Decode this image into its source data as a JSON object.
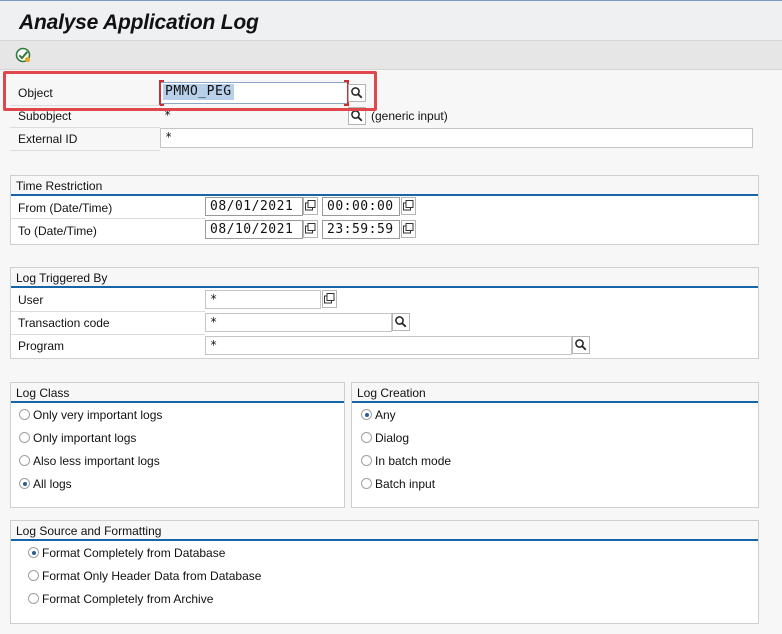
{
  "window": {
    "title": "Analyse Application Log"
  },
  "toolbar": {
    "execute_icon": "execute-icon"
  },
  "object": {
    "label": "Object",
    "value": "PMMO_PEG"
  },
  "subobject": {
    "label": "Subobject",
    "value": "*",
    "hint": "(generic input)"
  },
  "external_id": {
    "label": "External ID",
    "value": "*"
  },
  "time_restriction": {
    "title": "Time Restriction",
    "from": {
      "label": "From (Date/Time)",
      "date": "08/01/2021",
      "time": "00:00:00"
    },
    "to": {
      "label": "To (Date/Time)",
      "date": "08/10/2021",
      "time": "23:59:59"
    }
  },
  "log_triggered_by": {
    "title": "Log Triggered By",
    "user": {
      "label": "User",
      "value": "*"
    },
    "transaction": {
      "label": "Transaction code",
      "value": "*"
    },
    "program": {
      "label": "Program",
      "value": "*"
    }
  },
  "log_class": {
    "title": "Log Class",
    "options": [
      {
        "label": "Only very important logs",
        "selected": false
      },
      {
        "label": "Only important logs",
        "selected": false
      },
      {
        "label": "Also less important logs",
        "selected": false
      },
      {
        "label": "All logs",
        "selected": true
      }
    ]
  },
  "log_creation": {
    "title": "Log Creation",
    "options": [
      {
        "label": "Any",
        "selected": true
      },
      {
        "label": "Dialog",
        "selected": false
      },
      {
        "label": "In batch mode",
        "selected": false
      },
      {
        "label": "Batch input",
        "selected": false
      }
    ]
  },
  "log_source": {
    "title": "Log Source and Formatting",
    "options": [
      {
        "label": "Format Completely from Database",
        "selected": true
      },
      {
        "label": "Format Only Header Data from Database",
        "selected": false
      },
      {
        "label": "Format Completely from Archive",
        "selected": false
      }
    ]
  },
  "colors": {
    "accent": "#1565a8",
    "highlight": "#e0474c"
  }
}
